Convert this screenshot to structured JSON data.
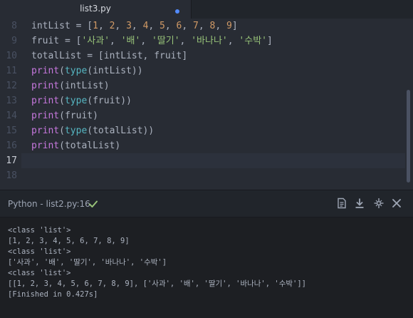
{
  "tab": {
    "title": "list3.py"
  },
  "colors": {
    "accent": "#528bff",
    "success": "#98c379",
    "editor_bg": "#282c34"
  },
  "editor": {
    "line_numbers": [
      "8",
      "9",
      "10",
      "11",
      "12",
      "13",
      "14",
      "15",
      "16",
      "17",
      "18"
    ],
    "active_line": "17",
    "lines": {
      "l8": {
        "a": "intList",
        "b": " = [",
        "n1": "1",
        "c1": ", ",
        "n2": "2",
        "c2": ", ",
        "n3": "3",
        "c3": ", ",
        "n4": "4",
        "c4": ", ",
        "n5": "5",
        "c5": ", ",
        "n6": "6",
        "c6": ", ",
        "n7": "7",
        "c7": ", ",
        "n8": "8",
        "c8": ", ",
        "n9": "9",
        "end": "]"
      },
      "l9": {
        "a": "fruit",
        "b": " = [",
        "s1": "'사과'",
        "c1": ", ",
        "s2": "'배'",
        "c2": ", ",
        "s3": "'딸기'",
        "c3": ", ",
        "s4": "'바나나'",
        "c4": ", ",
        "s5": "'수박'",
        "end": "]"
      },
      "l10": {
        "a": "totalList",
        "b": " = [intList, fruit]"
      },
      "l11": {
        "fn": "print",
        "p1": "(",
        "bi": "type",
        "rest": "(intList))"
      },
      "l12": {
        "fn": "print",
        "rest": "(intList)"
      },
      "l13": {
        "fn": "print",
        "p1": "(",
        "bi": "type",
        "rest": "(fruit))"
      },
      "l14": {
        "fn": "print",
        "rest": "(fruit)"
      },
      "l15": {
        "fn": "print",
        "p1": "(",
        "bi": "type",
        "rest": "(totalList))"
      },
      "l16": {
        "fn": "print",
        "rest": "(totalList)"
      }
    }
  },
  "panel": {
    "title": "Python - list2.py:16",
    "status_icon": "check-icon",
    "tools": [
      "document-icon",
      "download-icon",
      "pin-icon",
      "close-icon"
    ],
    "output": [
      "<class 'list'>",
      "[1, 2, 3, 4, 5, 6, 7, 8, 9]",
      "<class 'list'>",
      "['사과', '배', '딸기', '바나나', '수박']",
      "<class 'list'>",
      "[[1, 2, 3, 4, 5, 6, 7, 8, 9], ['사과', '배', '딸기', '바나나', '수박']]",
      "[Finished in 0.427s]"
    ]
  }
}
